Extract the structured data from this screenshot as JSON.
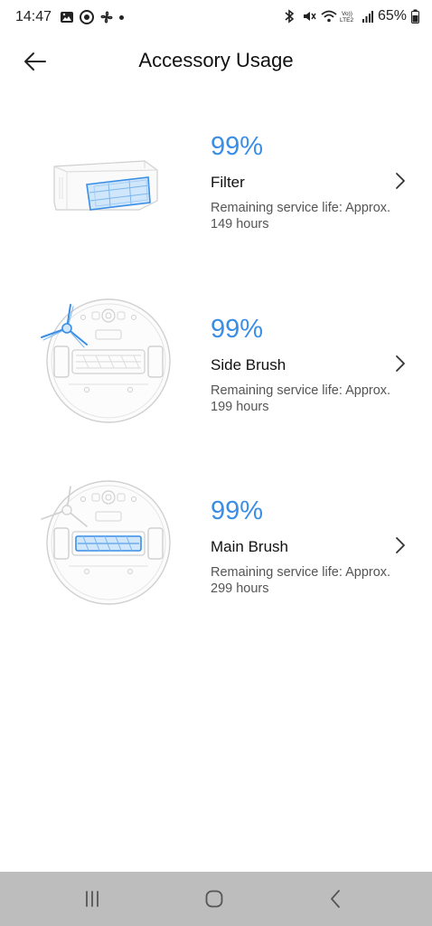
{
  "status_bar": {
    "time": "14:47",
    "battery_percent": "65%",
    "network_label": "VoLTE2",
    "icons": [
      "image-icon",
      "media-icon",
      "fan-icon",
      "dot-icon",
      "bluetooth-icon",
      "mute-icon",
      "wifi-icon",
      "volte-icon",
      "signal-icon",
      "battery-icon"
    ]
  },
  "header": {
    "title": "Accessory Usage",
    "back_icon": "back-arrow-icon"
  },
  "accessories": [
    {
      "percent": "99%",
      "name": "Filter",
      "life_line1": "Remaining service life: Approx.",
      "life_line2": "149 hours",
      "image_icon": "filter-illustration"
    },
    {
      "percent": "99%",
      "name": "Side Brush",
      "life_line1": "Remaining service life: Approx.",
      "life_line2": "199 hours",
      "image_icon": "side-brush-illustration"
    },
    {
      "percent": "99%",
      "name": "Main Brush",
      "life_line1": "Remaining service life: Approx.",
      "life_line2": "299 hours",
      "image_icon": "main-brush-illustration"
    }
  ],
  "nav_bar": {
    "recents_icon": "recents-icon",
    "home_icon": "home-icon",
    "back_icon": "nav-back-icon"
  },
  "colors": {
    "accent": "#3a8ee6",
    "nav_bar_bg": "#bdbdbd",
    "text_primary": "#111111",
    "text_secondary": "#555555"
  }
}
